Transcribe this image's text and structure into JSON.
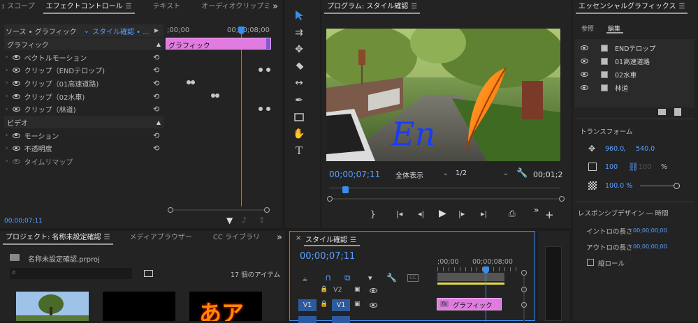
{
  "effect_panel": {
    "tabs": [
      "ｪ スコープ",
      "エフェクトコントロール",
      "テキスト",
      "オーディオクリップミ"
    ],
    "more": "»",
    "source_label": "ソース • グラフィック",
    "source_selected": "スタイル確認 • ...",
    "timecode_start": ";00;00",
    "timecode_mid": "00;00;08;00",
    "clip_name": "グラフィック",
    "section_graphic": "グラフィック",
    "rows_graphic": [
      "ベクトルモーション",
      "クリップ（ENDテロップ)",
      "クリップ（01高速道路)",
      "クリップ（02水車)",
      "クリップ（林道)"
    ],
    "section_video": "ビデオ",
    "rows_video": [
      "モーション",
      "不透明度",
      "タイムリマップ"
    ],
    "current_time": "00;00;07;11"
  },
  "program_panel": {
    "title": "プログラム: スタイル確認",
    "overlay_text": "En",
    "timecode": "00;00;07;11",
    "zoom": "全体表示",
    "resolution": "1/2",
    "duration": "00;01;2"
  },
  "essential_graphics": {
    "title": "エッセンシャルグラフィックス",
    "tabs": [
      "参照",
      "編集"
    ],
    "layers": [
      "ENDテロップ",
      "01高速道路",
      "02水車",
      "林道"
    ],
    "transform_label": "トランスフォーム",
    "pos_x": "960.0",
    "pos_y": "540.0",
    "scale": "100",
    "scale_locked": "100",
    "percent": "%",
    "opacity": "100.0 %",
    "responsive_label": "レスポンシブデザイン ― 時間",
    "intro_label": "イントロの長さ",
    "intro_value": "00;00;00;00",
    "outro_label": "アウトロの長さ",
    "outro_value": "00;00;00;00",
    "roll_label": "縦ロール"
  },
  "project_panel": {
    "tabs": [
      "プロジェクト: 名称未設定確認",
      "メディアブラウザー",
      "CC ライブラリ"
    ],
    "file_name": "名称未設定確認.prproj",
    "item_count": "17 個のアイテム",
    "thumb_text": "あア"
  },
  "timeline_panel": {
    "title": "スタイル確認",
    "timecode": "00;00;07;11",
    "ruler_start": ";00;00",
    "ruler_mid": "00;00;08;00",
    "track_v2": "V2",
    "track_v1": "V1",
    "source_v1": "V1",
    "clip_name": "グラフィック",
    "fx_badge": "fx"
  },
  "colors": {
    "accent": "#3a8df0",
    "clip_pink": "#e07ce0",
    "panel_bg": "#232323"
  }
}
